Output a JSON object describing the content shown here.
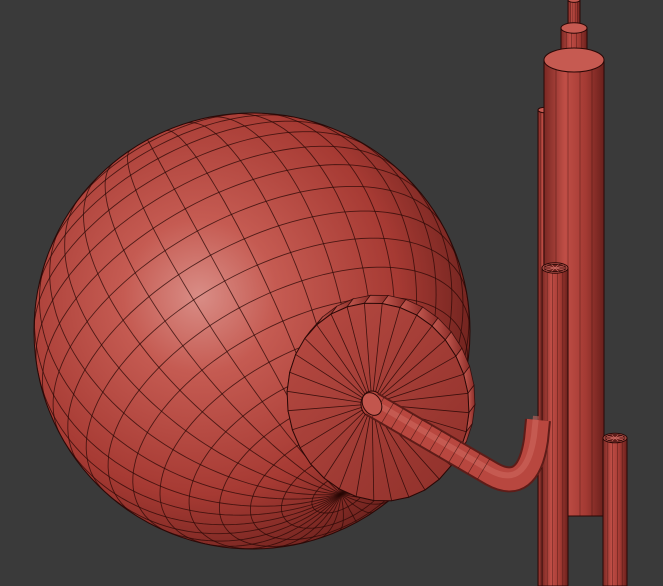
{
  "scene": {
    "type": "3d-viewport-wireframe-render",
    "background_color": "#3a3a3a",
    "mesh_color": "#b3413a",
    "mesh_highlight_color": "#d88880",
    "mesh_shadow_color": "#5a1a16",
    "wire_color": "#2a0806",
    "objects": [
      "sphere-lamp-shade",
      "disc-cap",
      "bent-arm-pipe",
      "vertical-pole-cluster"
    ]
  }
}
